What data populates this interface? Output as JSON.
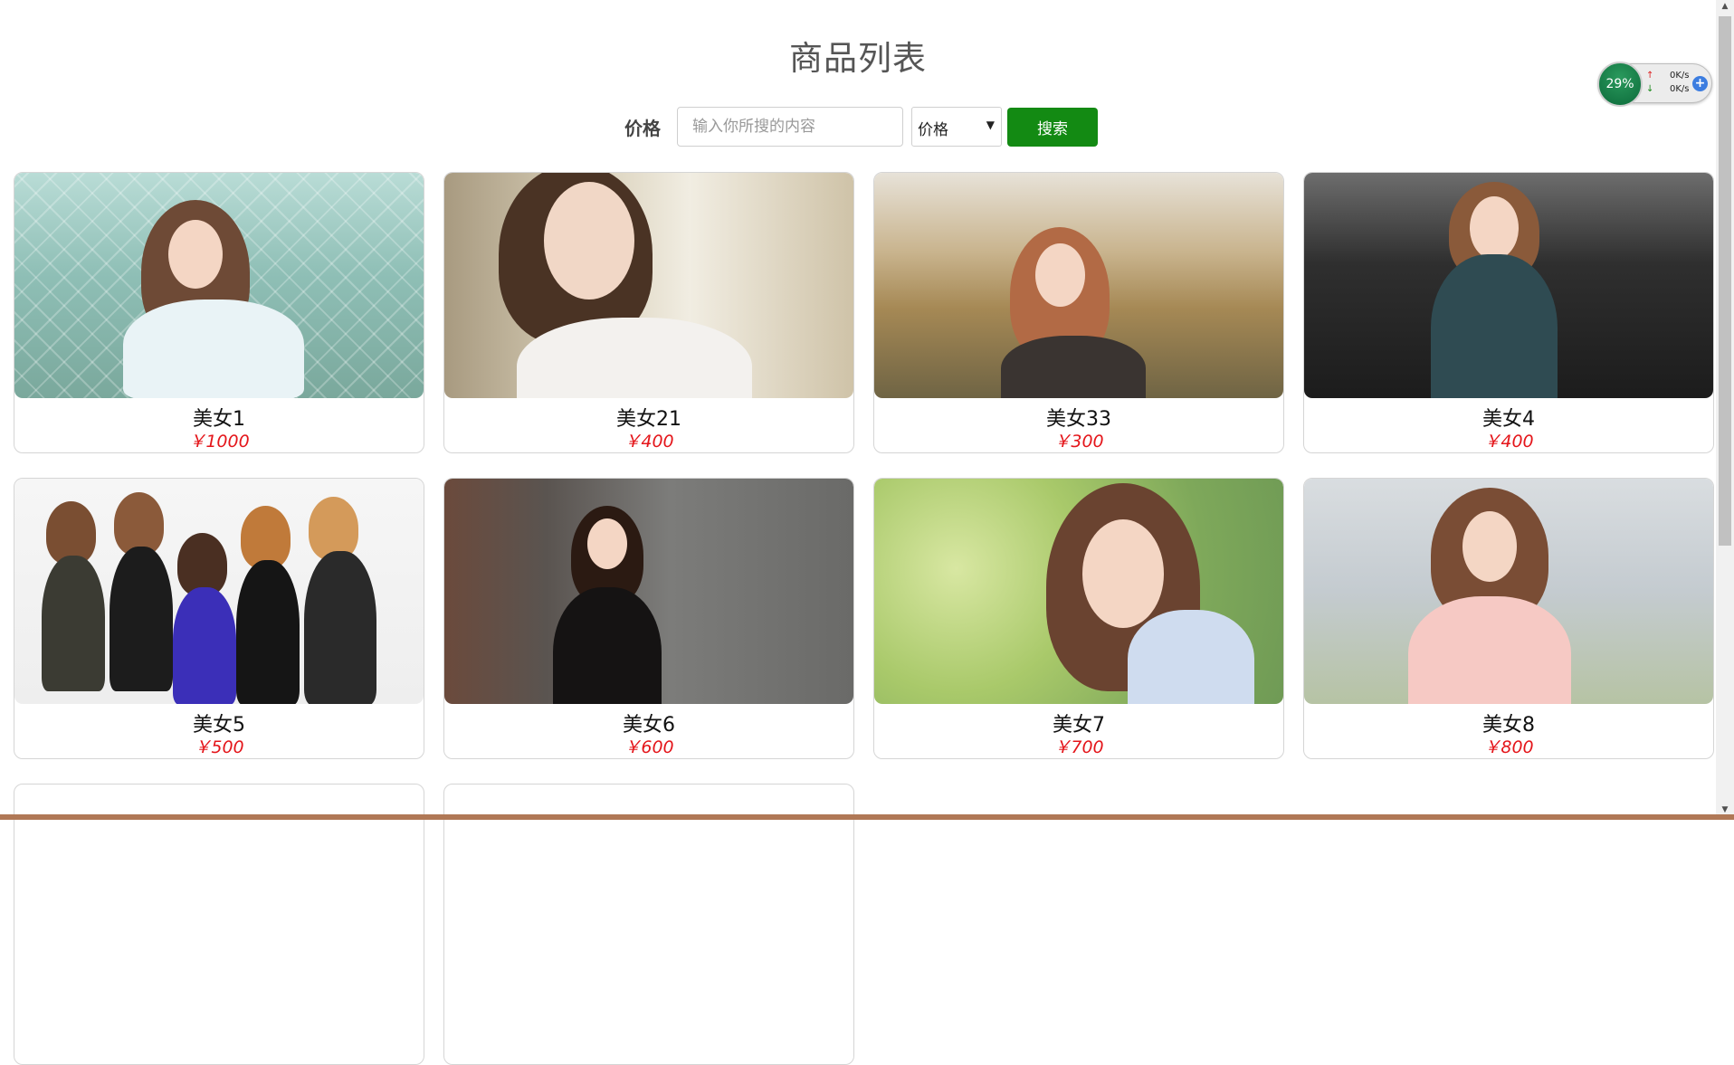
{
  "page": {
    "title": "商品列表"
  },
  "search": {
    "label": "价格",
    "placeholder": "输入你所搜的内容",
    "select_value": "价格",
    "button_label": "搜索"
  },
  "products": [
    {
      "name": "美女1",
      "price": "￥1000"
    },
    {
      "name": "美女21",
      "price": "￥400"
    },
    {
      "name": "美女33",
      "price": "￥300"
    },
    {
      "name": "美女4",
      "price": "￥400"
    },
    {
      "name": "美女5",
      "price": "￥500"
    },
    {
      "name": "美女6",
      "price": "￥600"
    },
    {
      "name": "美女7",
      "price": "￥700"
    },
    {
      "name": "美女8",
      "price": "￥800"
    }
  ],
  "widget": {
    "percent": "29%",
    "upload": "0K/s",
    "download": "0K/s"
  },
  "colors": {
    "accent": "#138a13",
    "price": "#e4151a"
  }
}
